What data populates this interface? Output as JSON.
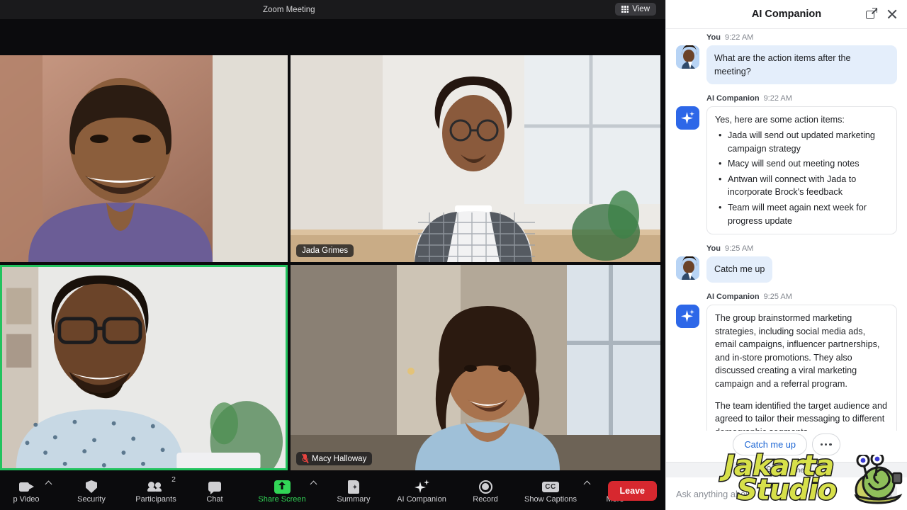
{
  "meeting": {
    "window_title": "Zoom Meeting",
    "view_button": "View",
    "view_icon": "grid-icon",
    "tiles": [
      {
        "name": "",
        "label_visible": false,
        "muted": false,
        "active_speaker": false
      },
      {
        "name": "Jada Grimes",
        "label_visible": true,
        "muted": false,
        "active_speaker": false
      },
      {
        "name": "",
        "label_visible": false,
        "muted": false,
        "active_speaker": true
      },
      {
        "name": "Macy Halloway",
        "label_visible": true,
        "muted": true,
        "active_speaker": false
      }
    ]
  },
  "toolbar": {
    "items": [
      {
        "label": "p Video",
        "icon": "video-camera-icon",
        "has_chevron": true,
        "highlight": false,
        "badge": ""
      },
      {
        "label": "Security",
        "icon": "shield-icon",
        "has_chevron": false,
        "highlight": false,
        "badge": ""
      },
      {
        "label": "Participants",
        "icon": "people-icon",
        "has_chevron": false,
        "highlight": false,
        "badge": "2"
      },
      {
        "label": "Chat",
        "icon": "chat-bubble-icon",
        "has_chevron": false,
        "highlight": false,
        "badge": ""
      },
      {
        "label": "Share Screen",
        "icon": "share-screen-icon",
        "has_chevron": true,
        "highlight": true,
        "badge": ""
      },
      {
        "label": "Summary",
        "icon": "summary-doc-icon",
        "has_chevron": false,
        "highlight": false,
        "badge": ""
      },
      {
        "label": "AI Companion",
        "icon": "sparkle-icon",
        "has_chevron": false,
        "highlight": false,
        "badge": ""
      },
      {
        "label": "Record",
        "icon": "record-circle-icon",
        "has_chevron": false,
        "highlight": false,
        "badge": ""
      },
      {
        "label": "Show Captions",
        "icon": "cc-icon",
        "has_chevron": true,
        "highlight": false,
        "badge": ""
      },
      {
        "label": "More",
        "icon": "ellipsis-icon",
        "has_chevron": false,
        "highlight": false,
        "badge": ""
      }
    ],
    "leave_label": "Leave"
  },
  "panel": {
    "title": "AI Companion",
    "popout_icon": "pop-out-icon",
    "close_icon": "close-icon",
    "messages": [
      {
        "role": "user",
        "sender": "You",
        "time": "9:22 AM",
        "paragraphs": [
          "What are the action items after the meeting?"
        ],
        "bullets": []
      },
      {
        "role": "ai",
        "sender": "AI Companion",
        "time": "9:22 AM",
        "paragraphs": [
          "Yes, here are some action items:"
        ],
        "bullets": [
          "Jada will send out updated marketing campaign strategy",
          "Macy will send out meeting notes",
          "Antwan will connect with Jada to incorporate Brock's feedback",
          "Team will meet again next week for progress update"
        ]
      },
      {
        "role": "user",
        "sender": "You",
        "time": "9:25 AM",
        "paragraphs": [
          "Catch me up"
        ],
        "bullets": []
      },
      {
        "role": "ai",
        "sender": "AI Companion",
        "time": "9:25 AM",
        "paragraphs": [
          "The group brainstormed marketing strategies, including social media ads, email campaigns, influencer partnerships, and in-store promotions. They also discussed creating a viral marketing campaign and a referral program.",
          "The team identified the target audience and agreed to tailor their messaging to different demographic segments."
        ],
        "bullets": []
      }
    ],
    "suggestions": [
      {
        "label": "Catch me up",
        "type": "chip"
      },
      {
        "label": "",
        "type": "more"
      }
    ],
    "privacy_note": "No other",
    "privacy_icon": "person-privacy-icon",
    "composer_placeholder": "Ask anything abou",
    "send_icon": "send-icon"
  },
  "watermark": {
    "line1": "Jakarta",
    "line2": "Studio",
    "mascot": "snail-mascot"
  },
  "colors": {
    "accent_blue": "#2d67e8",
    "link_blue": "#1a64d4",
    "active_speaker_green": "#22c35e",
    "share_green": "#32d657",
    "leave_red": "#d7282f",
    "user_bubble": "#e4eefb",
    "panel_bg": "#ffffff",
    "meeting_bg": "#0b0b0d"
  }
}
